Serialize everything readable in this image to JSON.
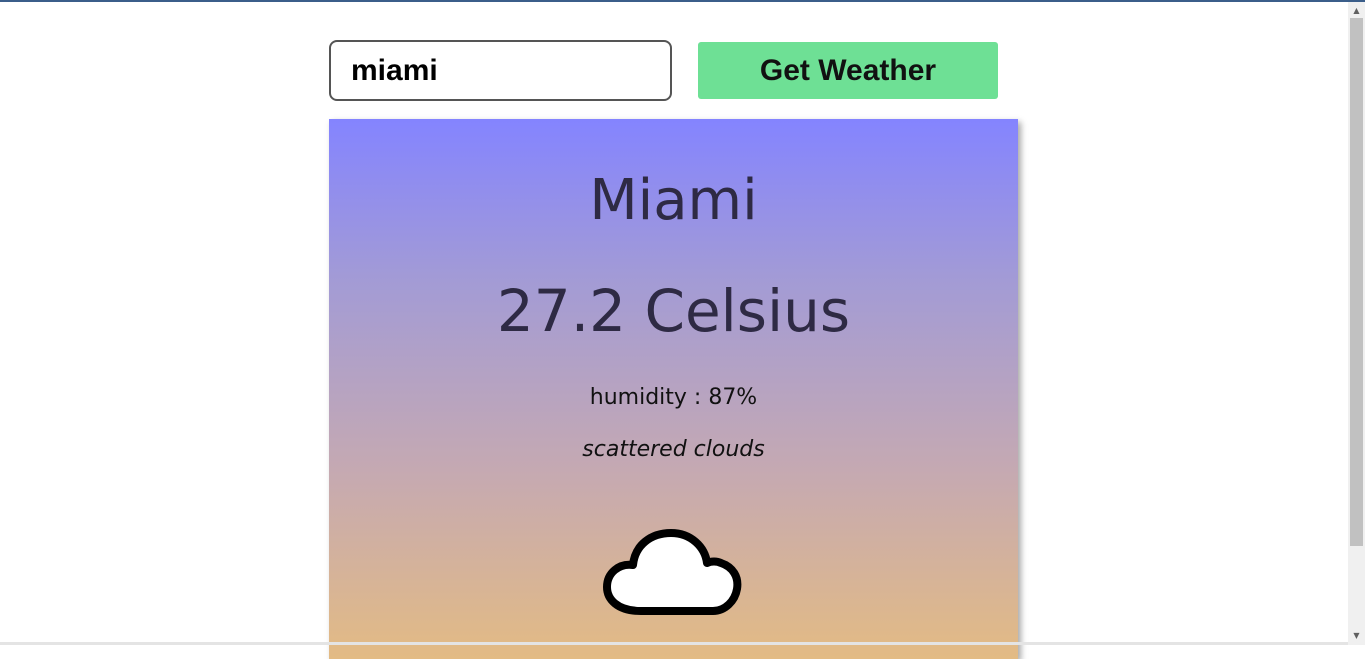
{
  "search": {
    "value": "miami"
  },
  "button": {
    "label": "Get Weather"
  },
  "weather": {
    "city": "Miami",
    "temperature": "27.2 Celsius",
    "humidity": "humidity : 87%",
    "description": "scattered clouds",
    "icon": "cloud-icon"
  },
  "colors": {
    "button": "#6ee095",
    "card_gradient_top": "#8484ff",
    "card_gradient_bottom": "#e3bb84",
    "heading_text": "#2e2a44"
  }
}
